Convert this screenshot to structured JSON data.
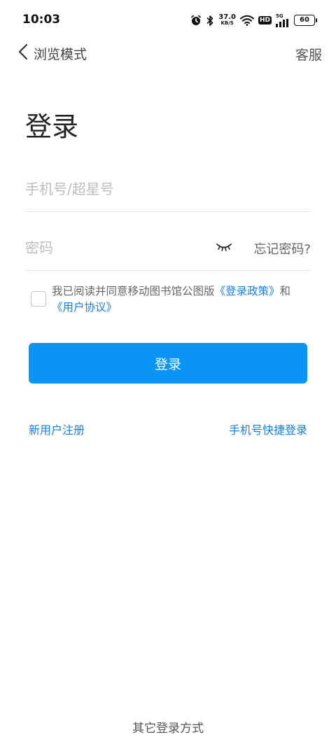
{
  "status_bar": {
    "time": "10:03",
    "net_speed_value": "37.0",
    "net_speed_unit": "KB/S",
    "hd_label": "HD",
    "signal_label": "5G",
    "battery_level": "60"
  },
  "nav": {
    "back_label": "浏览模式",
    "service_label": "客服"
  },
  "page": {
    "title": "登录"
  },
  "form": {
    "account_placeholder": "手机号/超星号",
    "account_value": "",
    "password_placeholder": "密码",
    "password_value": "",
    "forgot_label": "忘记密码?"
  },
  "agreement": {
    "checked": false,
    "text_prefix": "我已阅读并同意移动图书馆公图版",
    "policy_link": "《登录政策》",
    "and_text": "和",
    "terms_link": "《用户协议》"
  },
  "login_button_label": "登录",
  "links": {
    "register": "新用户注册",
    "quick_login": "手机号快捷登录"
  },
  "footer": {
    "other_login": "其它登录方式"
  },
  "colors": {
    "accent": "#0a95f5",
    "link": "#1a7fd9"
  }
}
